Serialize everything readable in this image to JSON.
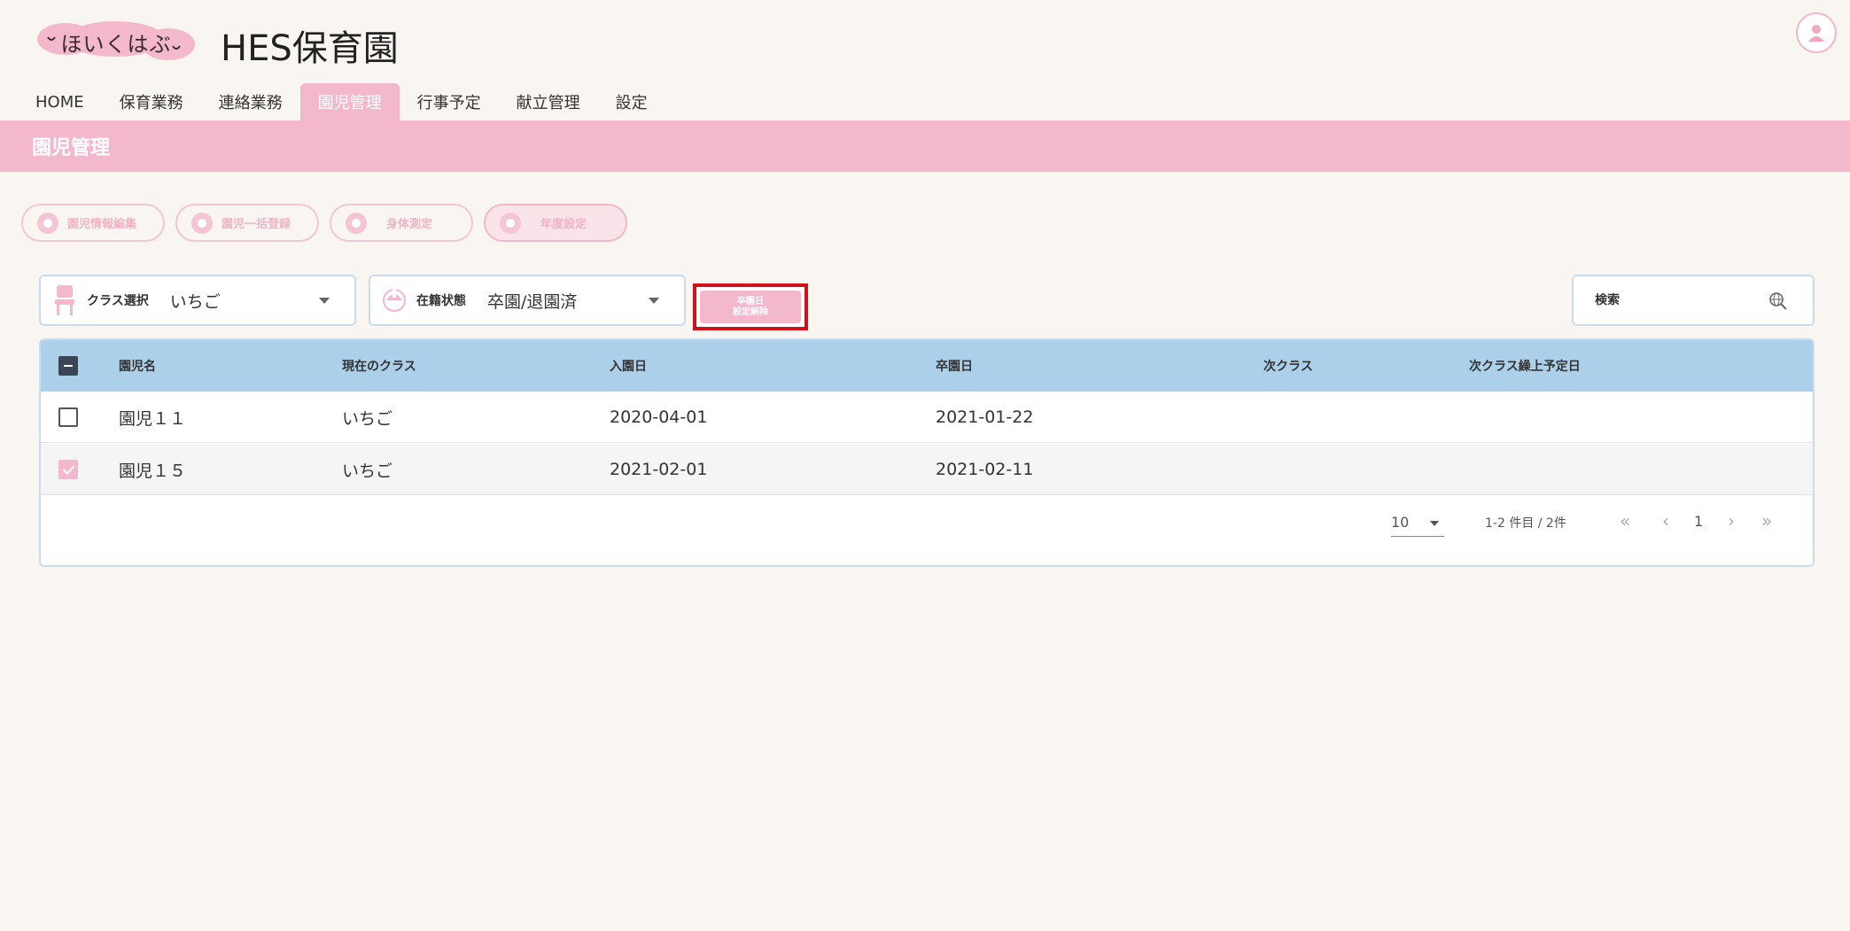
{
  "header": {
    "logo_text": "ほいくはぶ",
    "org_name": "HES保育園"
  },
  "nav": {
    "tabs": [
      "HOME",
      "保育業務",
      "連絡業務",
      "園児管理",
      "行事予定",
      "献立管理",
      "設定"
    ],
    "active": "園児管理"
  },
  "banner": {
    "title": "園児管理"
  },
  "actions": {
    "child_info_edit": "園児情報編集",
    "bulk_register": "園児一括登録",
    "body_measure": "身体測定",
    "year_settings": "年度設定"
  },
  "filters": {
    "class_label": "クラス選択",
    "class_value": "いちご",
    "status_label": "在籍状態",
    "status_value": "卒園/退園済",
    "clear_button_line1": "卒園日",
    "clear_button_line2": "設定解除",
    "search_placeholder": "検索"
  },
  "table": {
    "headers": {
      "name": "園児名",
      "current_class": "現在のクラス",
      "enter_date": "入園日",
      "grad_date": "卒園日",
      "next_class": "次クラス",
      "next_class_date": "次クラス繰上予定日"
    },
    "rows": [
      {
        "name": "園児１１",
        "current_class": "いちご",
        "enter_date": "2020-04-01",
        "grad_date": "2021-01-22",
        "next_class": "",
        "next_class_date": "",
        "checked": false
      },
      {
        "name": "園児１５",
        "current_class": "いちご",
        "enter_date": "2021-02-01",
        "grad_date": "2021-02-11",
        "next_class": "",
        "next_class_date": "",
        "checked": true
      }
    ]
  },
  "pagination": {
    "per_page": "10",
    "range": "1-2 件目 / 2件",
    "first": "«",
    "prev": "‹",
    "page": "1",
    "next": "›",
    "last": "»"
  },
  "colors": {
    "accent_pink": "#f4b8cc",
    "header_blue": "#acd0ea",
    "highlight_red": "#d0101a",
    "background": "#f9f6f2"
  },
  "icons": {
    "avatar": "person-icon",
    "search": "globe-search-icon",
    "class": "chair-icon",
    "status": "helmet-icon"
  }
}
